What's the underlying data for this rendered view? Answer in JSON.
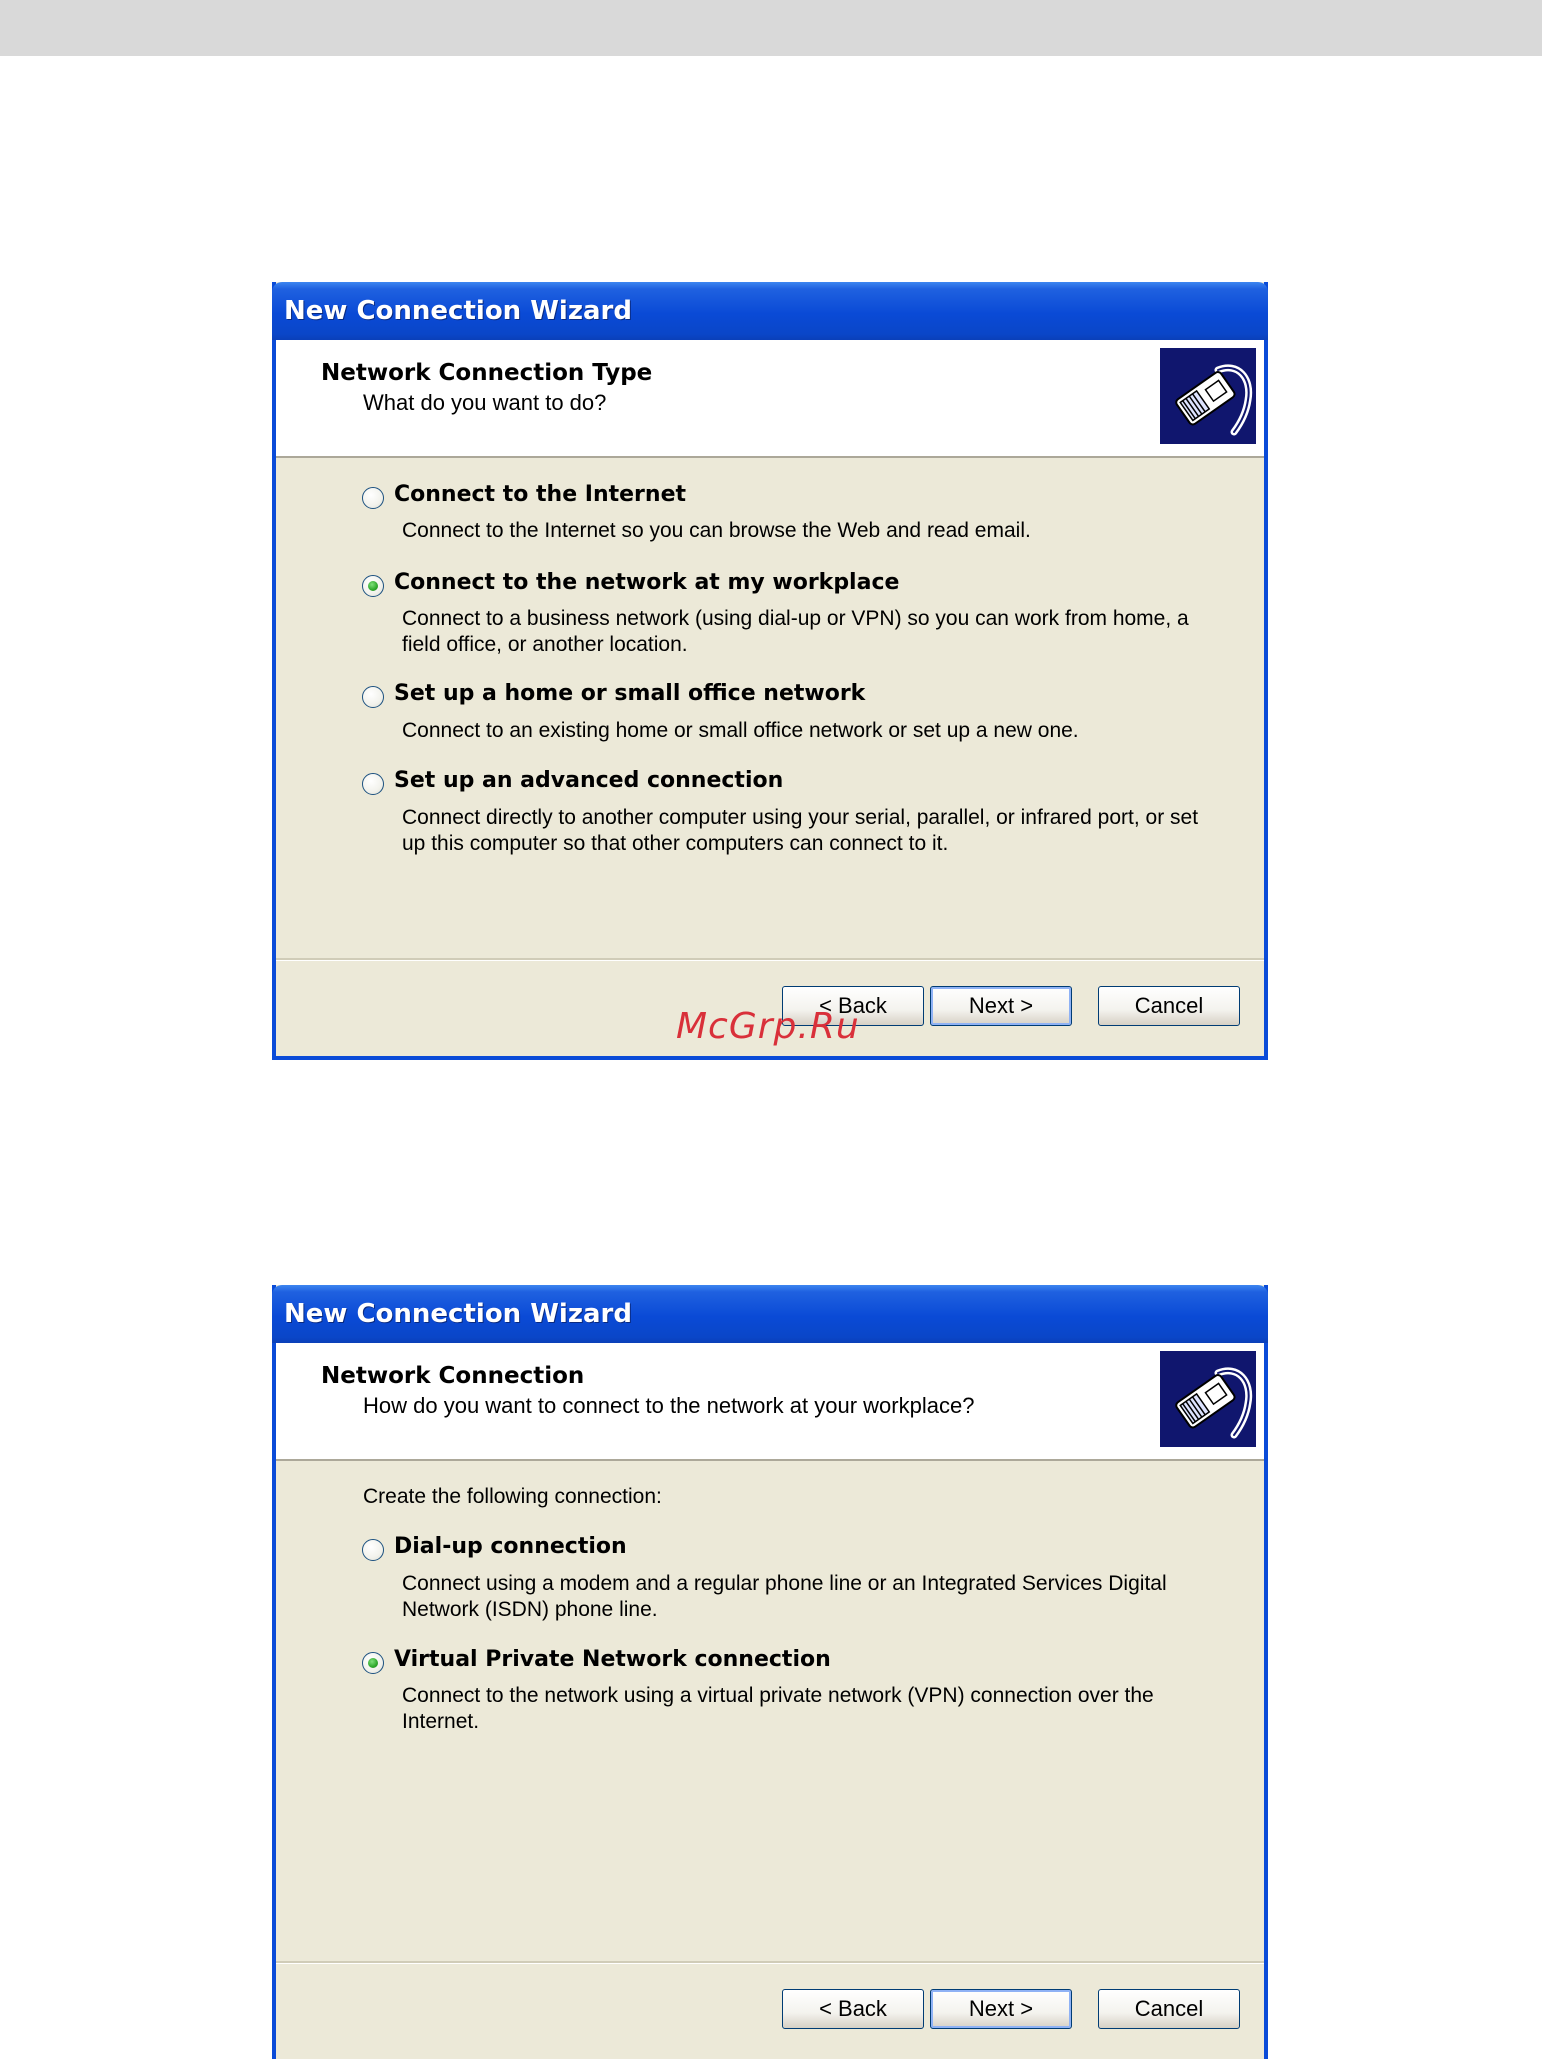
{
  "wizard1": {
    "title": "New Connection Wizard",
    "header_title": "Network Connection Type",
    "header_subtitle": "What do you want to do?",
    "icon": "network-cable-icon",
    "options": [
      {
        "label": "Connect to the Internet",
        "desc": "Connect to the Internet so you can browse the Web and read email.",
        "selected": false
      },
      {
        "label": "Connect to the network at my workplace",
        "desc": "Connect to a business network (using dial-up or VPN) so you can work from home, a field office, or another location.",
        "selected": true
      },
      {
        "label": "Set up a home or small office network",
        "desc": "Connect to an existing home or small office network or set up a new one.",
        "selected": false
      },
      {
        "label": "Set up an advanced connection",
        "desc": "Connect directly to another computer using your serial, parallel, or infrared port, or set up this computer so that other computers can connect to it.",
        "selected": false
      }
    ],
    "buttons": {
      "back": "< Back",
      "next": "Next >",
      "cancel": "Cancel"
    }
  },
  "wizard2": {
    "title": "New Connection Wizard",
    "header_title": "Network Connection",
    "header_subtitle": "How do you want to connect to the network at your workplace?",
    "icon": "network-cable-icon",
    "lead": "Create the following connection:",
    "options": [
      {
        "label": "Dial-up connection",
        "desc": "Connect using a modem and a regular phone line or an Integrated Services Digital Network (ISDN) phone line.",
        "selected": false
      },
      {
        "label": "Virtual Private Network connection",
        "desc": "Connect to the network using a virtual private network (VPN) connection over the Internet.",
        "selected": true
      }
    ],
    "buttons": {
      "back": "< Back",
      "next": "Next >",
      "cancel": "Cancel"
    }
  },
  "watermark": "McGrp.Ru",
  "colors": {
    "titlebar": "#0a4ad6",
    "dialog_bg": "#ece9d8",
    "watermark": "#d9303a"
  }
}
